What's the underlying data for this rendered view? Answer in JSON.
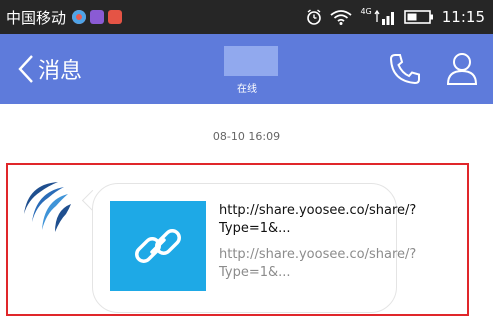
{
  "status_bar": {
    "carrier": "中国移动",
    "network_type": "4G",
    "time": "11:15",
    "notification_icons": [
      "browser-icon",
      "app-icon",
      "app-icon"
    ],
    "system_icons": [
      "alarm-icon",
      "wifi-icon",
      "signal-icon",
      "battery-icon"
    ]
  },
  "header": {
    "back_label": "消息",
    "contact_status": "在线",
    "background_color": "#5e7bdb"
  },
  "chat": {
    "timestamp": "08-10 16:09",
    "message": {
      "link_title": "http://share.yoosee.co/share/?Type=1&...",
      "link_description": "http://share.yoosee.co/share/?Type=1&...",
      "thumbnail_icon": "link-icon",
      "thumbnail_color": "#1ea9e6"
    }
  }
}
